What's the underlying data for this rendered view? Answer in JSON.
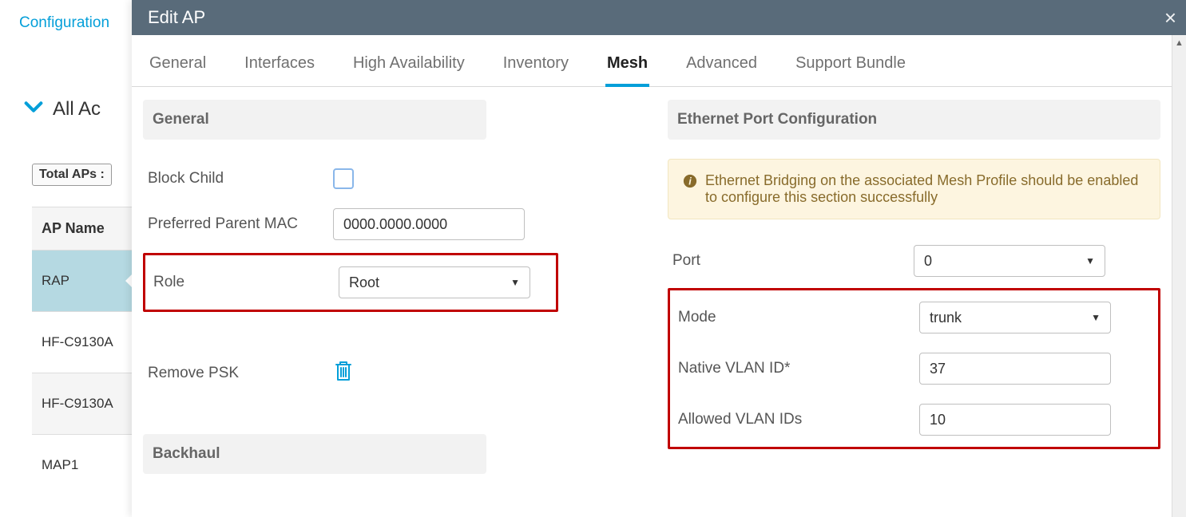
{
  "background": {
    "breadcrumb": "Configuration",
    "section_title": "All Ac",
    "filter_label": "Total APs :",
    "column_header": "AP Name",
    "rows": [
      "RAP",
      "HF-C9130A",
      "HF-C9130A",
      "MAP1"
    ]
  },
  "panel": {
    "title": "Edit AP",
    "tabs": {
      "general": "General",
      "interfaces": "Interfaces",
      "high_availability": "High Availability",
      "inventory": "Inventory",
      "mesh": "Mesh",
      "advanced": "Advanced",
      "support_bundle": "Support Bundle"
    },
    "left": {
      "section_general": "General",
      "block_child_label": "Block Child",
      "preferred_parent_mac_label": "Preferred Parent MAC",
      "preferred_parent_mac_value": "0000.0000.0000",
      "role_label": "Role",
      "role_value": "Root",
      "remove_psk_label": "Remove PSK",
      "section_backhaul": "Backhaul"
    },
    "right": {
      "section_eth": "Ethernet Port Configuration",
      "info_text": "Ethernet Bridging on the associated Mesh Profile should be enabled to configure this section successfully",
      "port_label": "Port",
      "port_value": "0",
      "mode_label": "Mode",
      "mode_value": "trunk",
      "native_vlan_label": "Native VLAN ID*",
      "native_vlan_value": "37",
      "allowed_vlan_label": "Allowed VLAN IDs",
      "allowed_vlan_value": "10"
    }
  }
}
